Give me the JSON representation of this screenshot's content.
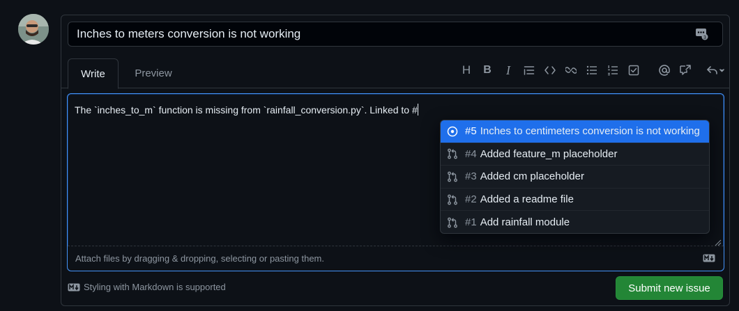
{
  "issue": {
    "title": "Inches to meters conversion is not working"
  },
  "tabs": [
    {
      "label": "Write",
      "active": true
    },
    {
      "label": "Preview",
      "active": false
    }
  ],
  "toolbar": {
    "items": [
      "heading-icon",
      "bold-icon",
      "italic-icon",
      "quote-icon",
      "code-icon",
      "link-icon",
      "unordered-list-icon",
      "ordered-list-icon",
      "task-list-icon",
      "mention-icon",
      "cross-reference-icon",
      "saved-replies-icon"
    ],
    "heading_glyph": "H",
    "bold_glyph": "B",
    "italic_glyph": "I"
  },
  "editor": {
    "text": "The `inches_to_m` function is missing from `rainfall_conversion.py`. Linked to #",
    "attach_hint": "Attach files by dragging & dropping, selecting or pasting them."
  },
  "suggestions": [
    {
      "number": "#5",
      "title": "Inches to centimeters conversion is not working",
      "kind": "issue-open-icon",
      "active": true
    },
    {
      "number": "#4",
      "title": "Added feature_m placeholder",
      "kind": "pull-request-icon",
      "active": false
    },
    {
      "number": "#3",
      "title": "Added cm placeholder",
      "kind": "pull-request-icon",
      "active": false
    },
    {
      "number": "#2",
      "title": "Added a readme file",
      "kind": "pull-request-icon",
      "active": false
    },
    {
      "number": "#1",
      "title": "Add rainfall module",
      "kind": "pull-request-icon",
      "active": false
    }
  ],
  "footer": {
    "markdown_note": "Styling with Markdown is supported",
    "submit_label": "Submit new issue"
  },
  "colors": {
    "accent": "#1f6feb",
    "submit": "#238636",
    "background": "#0d1117"
  }
}
